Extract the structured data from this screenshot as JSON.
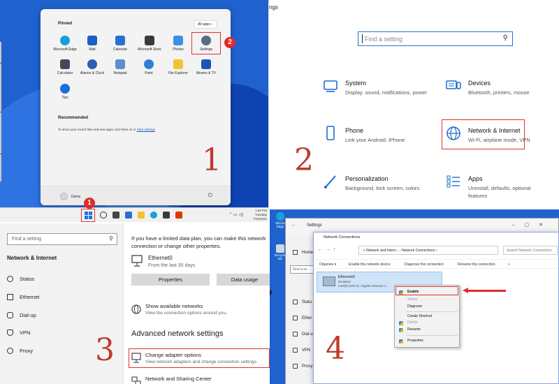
{
  "panel1": {
    "pinned_label": "Pinned",
    "all_apps": "All apps  ›",
    "apps": [
      {
        "label": "Microsoft Edge",
        "icon": "edge-icon",
        "color": "#1aa0d8"
      },
      {
        "label": "Mail",
        "icon": "mail-icon",
        "color": "#1b5fc2"
      },
      {
        "label": "Calendar",
        "icon": "calendar-icon",
        "color": "#2a6fd1"
      },
      {
        "label": "Microsoft Store",
        "icon": "store-icon",
        "color": "#3a3a3a"
      },
      {
        "label": "Photos",
        "icon": "photos-icon",
        "color": "#3d8fe3"
      },
      {
        "label": "Settings",
        "icon": "gear-icon",
        "color": "#5b6a80"
      },
      {
        "label": "Calculator",
        "icon": "calculator-icon",
        "color": "#404a5a"
      },
      {
        "label": "Alarms & Clock",
        "icon": "clock-icon",
        "color": "#2f5fb0"
      },
      {
        "label": "Notepad",
        "icon": "notepad-icon",
        "color": "#5a8fcf"
      },
      {
        "label": "Paint",
        "icon": "paint-icon",
        "color": "#2e7fd6"
      },
      {
        "label": "File Explorer",
        "icon": "folder-icon",
        "color": "#f2c230"
      },
      {
        "label": "Movies & TV",
        "icon": "movies-icon",
        "color": "#1a56b8"
      },
      {
        "label": "Tips",
        "icon": "tips-icon",
        "color": "#1b6fd8"
      }
    ],
    "recommended_label": "Recommended",
    "recommended_text": "To show your recent files and new apps, turn them on in",
    "recommended_link": "Start settings",
    "user_name": "Demo",
    "step_number": "1",
    "badge_1": "1",
    "badge_2": "2"
  },
  "taskbar": {
    "tray_icons": "⌃ ▭ ◁)",
    "time": "1:52 PM",
    "day": "Tuesday",
    "date": "7/13/2021"
  },
  "panel2": {
    "window_title": "ngs",
    "search_placeholder": "Find a setting",
    "categories": [
      {
        "title": "System",
        "desc": "Display, sound, notifications, power",
        "icon": "laptop-icon"
      },
      {
        "title": "Devices",
        "desc": "Bluetooth, printers, mouse",
        "icon": "keyboard-icon"
      },
      {
        "title": "Phone",
        "desc": "Link your Android, iPhone",
        "icon": "phone-icon"
      },
      {
        "title": "Network & Internet",
        "desc": "Wi-Fi, airplane mode, VPN",
        "icon": "globe-icon"
      },
      {
        "title": "Personalization",
        "desc": "Background, lock screen, colors",
        "icon": "brush-icon"
      },
      {
        "title": "Apps",
        "desc": "Uninstall, defaults, optional features",
        "icon": "apps-list-icon"
      }
    ],
    "step_number": "2"
  },
  "panel3": {
    "find_placeholder": "Find a setting",
    "section_title": "Network & Internet",
    "nav": [
      "Status",
      "Ethernet",
      "Dial-up",
      "VPN",
      "Proxy"
    ],
    "limited_text": "If you have a limited data plan, you can make this network connection or change other properties.",
    "ethernet_name": "Ethernet0",
    "ethernet_desc": "From the last 30 days",
    "properties_btn": "Properties",
    "data_usage_btn": "Data usage",
    "show_networks_title": "Show available networks",
    "show_networks_desc": "View the connection options around you.",
    "advanced_title": "Advanced network settings",
    "change_adapter_title": "Change adapter options",
    "change_adapter_desc": "View network adapters and change connection settings.",
    "sharing_title": "Network and Sharing Center",
    "step_number": "3"
  },
  "panel4": {
    "desktop_icons": [
      "Micros Edge",
      "Recycle Bin"
    ],
    "settings_title": "Settings",
    "settings_home": "Home",
    "settings_find": "Find a se",
    "settings_nav": [
      "Statu",
      "Ether",
      "Dial-u",
      "VPN",
      "Proxy"
    ],
    "nc_title": "Network Connections",
    "path_parts": "« Network and Intern... › Network Connections ›",
    "search_placeholder": "Search Network Connections",
    "commands": [
      "Organize ▾",
      "Enable this network device",
      "Diagnose this connection",
      "Rename this connection",
      "»"
    ],
    "item_name": "Ethernet0",
    "item_status": "Disabled",
    "item_adapter": "Intel(R) 82574L Gigabit Network C...",
    "context_menu": [
      {
        "label": "Enable",
        "disabled": false,
        "bold": true
      },
      {
        "label": "Status",
        "disabled": true
      },
      {
        "label": "Diagnose",
        "disabled": false
      },
      {
        "label": "Create Shortcut",
        "disabled": false
      },
      {
        "label": "Delete",
        "disabled": true
      },
      {
        "label": "Rename",
        "disabled": false
      },
      {
        "label": "Properties",
        "disabled": false
      }
    ],
    "step_number": "4"
  }
}
